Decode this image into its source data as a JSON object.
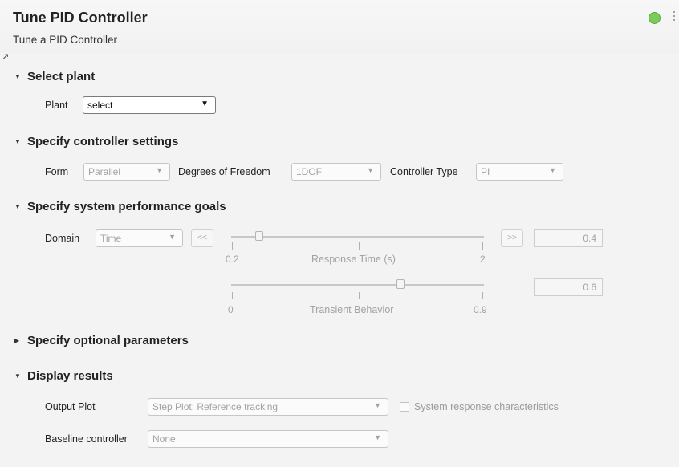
{
  "header": {
    "title": "Tune PID Controller",
    "subtitle": "Tune a PID Controller",
    "status_color": "#79cc5a"
  },
  "sections": {
    "select_plant": {
      "label": "Select plant",
      "plant_label": "Plant",
      "plant_value": "select"
    },
    "controller_settings": {
      "label": "Specify controller settings",
      "form_label": "Form",
      "form_value": "Parallel",
      "dof_label": "Degrees of Freedom",
      "dof_value": "1DOF",
      "type_label": "Controller Type",
      "type_value": "PI"
    },
    "performance_goals": {
      "label": "Specify system performance goals",
      "domain_label": "Domain",
      "domain_value": "Time",
      "slower_label": "<<",
      "faster_label": ">>",
      "response_time": {
        "label": "Response Time (s)",
        "min_label": "0.2",
        "max_label": "2",
        "value": "0.4",
        "fraction": 0.11
      },
      "transient_behavior": {
        "label": "Transient Behavior",
        "min_label": "0",
        "max_label": "0.9",
        "value": "0.6",
        "fraction": 0.67
      }
    },
    "optional_parameters": {
      "label": "Specify optional parameters"
    },
    "display_results": {
      "label": "Display results",
      "output_plot_label": "Output Plot",
      "output_plot_value": "Step Plot: Reference tracking",
      "characteristics_label": "System response characteristics",
      "baseline_label": "Baseline controller",
      "baseline_value": "None"
    }
  },
  "icons": {
    "expanded": "caret-down-icon",
    "collapsed": "caret-right-icon",
    "dropdown": "dropdown-arrow-icon",
    "status": "status-dot-icon",
    "menu": "vertical-ellipsis-icon"
  }
}
